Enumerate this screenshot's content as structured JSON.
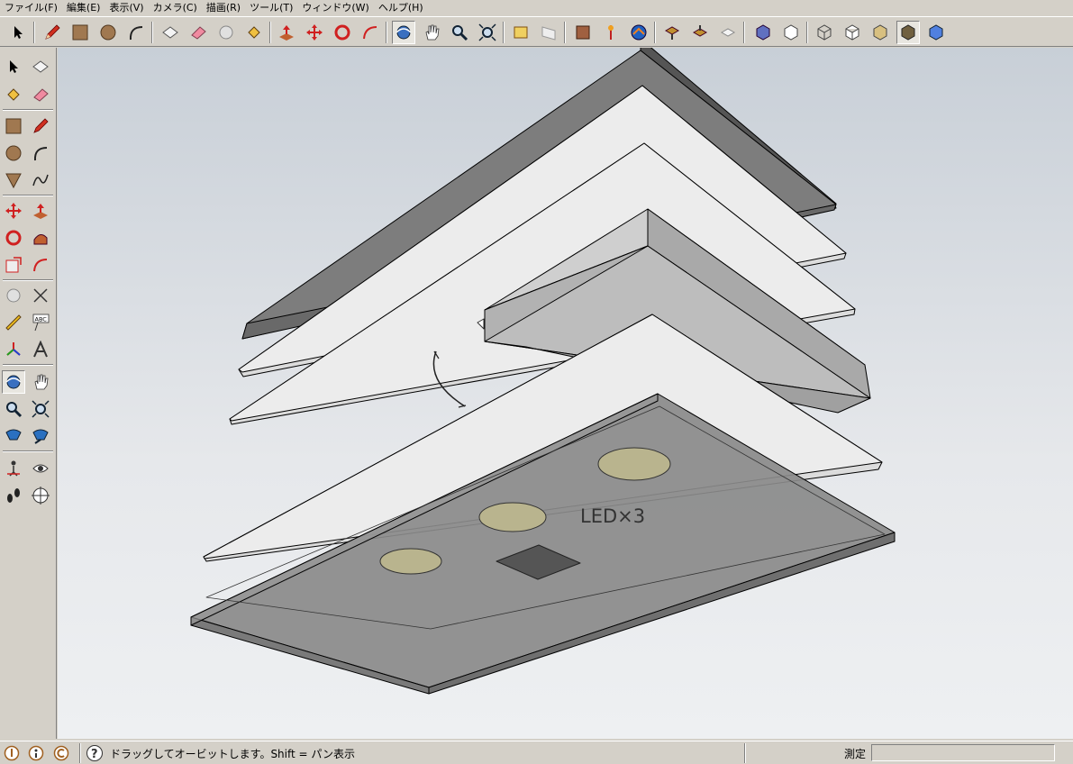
{
  "menu": [
    {
      "id": "file",
      "label": "ファイル(F)"
    },
    {
      "id": "edit",
      "label": "編集(E)"
    },
    {
      "id": "view",
      "label": "表示(V)"
    },
    {
      "id": "camera",
      "label": "カメラ(C)"
    },
    {
      "id": "draw",
      "label": "描画(R)"
    },
    {
      "id": "tools",
      "label": "ツール(T)"
    },
    {
      "id": "window",
      "label": "ウィンドウ(W)"
    },
    {
      "id": "help",
      "label": "ヘルプ(H)"
    }
  ],
  "toolbar_icons": [
    "select",
    "pencil",
    "rectangle",
    "circle",
    "arc",
    "make-component",
    "eraser",
    "tape-measure",
    "paint-bucket",
    "push-pull",
    "move",
    "rotate",
    "follow-me",
    "orbit",
    "pan",
    "zoom",
    "zoom-extents",
    "previous-view",
    "next-view",
    "standard-views",
    "add-location",
    "toggle-terrain",
    "google-earth",
    "get-models",
    "share-model",
    "share-component",
    "xray",
    "wireframe",
    "hidden-line",
    "shaded",
    "shaded-textures",
    "monochrome",
    "iso-view"
  ],
  "left_toolbar_icons": [
    "select",
    "make-component",
    "paint-bucket",
    "eraser",
    "rectangle",
    "line",
    "circle",
    "arc",
    "polygon",
    "freehand",
    "move",
    "push-pull",
    "rotate",
    "follow-me",
    "scale",
    "offset",
    "tape-measure",
    "dimension",
    "protractor",
    "text",
    "axes",
    "3d-text",
    "orbit",
    "pan",
    "zoom",
    "zoom-window",
    "zoom-extents",
    "previous-view",
    "position-camera",
    "look-around",
    "walk",
    "section-plane"
  ],
  "viewport": {
    "annotation_text": "LED×3",
    "background_top": "#c8cfd7",
    "background_bottom": "#eef0f2"
  },
  "status": {
    "message": "ドラッグしてオービットします。Shift = パン表示",
    "measure_label": "測定",
    "measure_value": ""
  }
}
